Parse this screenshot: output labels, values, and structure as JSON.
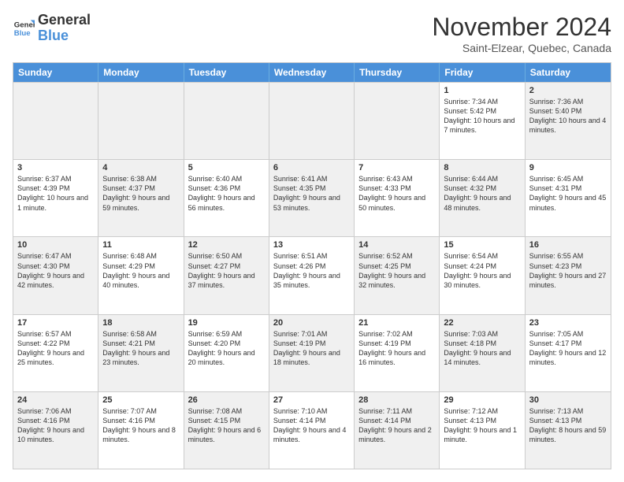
{
  "logo": {
    "line1": "General",
    "line2": "Blue"
  },
  "title": "November 2024",
  "subtitle": "Saint-Elzear, Quebec, Canada",
  "header_days": [
    "Sunday",
    "Monday",
    "Tuesday",
    "Wednesday",
    "Thursday",
    "Friday",
    "Saturday"
  ],
  "rows": [
    [
      {
        "day": "",
        "info": "",
        "shaded": true
      },
      {
        "day": "",
        "info": "",
        "shaded": true
      },
      {
        "day": "",
        "info": "",
        "shaded": true
      },
      {
        "day": "",
        "info": "",
        "shaded": true
      },
      {
        "day": "",
        "info": "",
        "shaded": true
      },
      {
        "day": "1",
        "info": "Sunrise: 7:34 AM\nSunset: 5:42 PM\nDaylight: 10 hours and 7 minutes.",
        "shaded": false
      },
      {
        "day": "2",
        "info": "Sunrise: 7:36 AM\nSunset: 5:40 PM\nDaylight: 10 hours and 4 minutes.",
        "shaded": true
      }
    ],
    [
      {
        "day": "3",
        "info": "Sunrise: 6:37 AM\nSunset: 4:39 PM\nDaylight: 10 hours and 1 minute.",
        "shaded": false
      },
      {
        "day": "4",
        "info": "Sunrise: 6:38 AM\nSunset: 4:37 PM\nDaylight: 9 hours and 59 minutes.",
        "shaded": true
      },
      {
        "day": "5",
        "info": "Sunrise: 6:40 AM\nSunset: 4:36 PM\nDaylight: 9 hours and 56 minutes.",
        "shaded": false
      },
      {
        "day": "6",
        "info": "Sunrise: 6:41 AM\nSunset: 4:35 PM\nDaylight: 9 hours and 53 minutes.",
        "shaded": true
      },
      {
        "day": "7",
        "info": "Sunrise: 6:43 AM\nSunset: 4:33 PM\nDaylight: 9 hours and 50 minutes.",
        "shaded": false
      },
      {
        "day": "8",
        "info": "Sunrise: 6:44 AM\nSunset: 4:32 PM\nDaylight: 9 hours and 48 minutes.",
        "shaded": true
      },
      {
        "day": "9",
        "info": "Sunrise: 6:45 AM\nSunset: 4:31 PM\nDaylight: 9 hours and 45 minutes.",
        "shaded": false
      }
    ],
    [
      {
        "day": "10",
        "info": "Sunrise: 6:47 AM\nSunset: 4:30 PM\nDaylight: 9 hours and 42 minutes.",
        "shaded": true
      },
      {
        "day": "11",
        "info": "Sunrise: 6:48 AM\nSunset: 4:29 PM\nDaylight: 9 hours and 40 minutes.",
        "shaded": false
      },
      {
        "day": "12",
        "info": "Sunrise: 6:50 AM\nSunset: 4:27 PM\nDaylight: 9 hours and 37 minutes.",
        "shaded": true
      },
      {
        "day": "13",
        "info": "Sunrise: 6:51 AM\nSunset: 4:26 PM\nDaylight: 9 hours and 35 minutes.",
        "shaded": false
      },
      {
        "day": "14",
        "info": "Sunrise: 6:52 AM\nSunset: 4:25 PM\nDaylight: 9 hours and 32 minutes.",
        "shaded": true
      },
      {
        "day": "15",
        "info": "Sunrise: 6:54 AM\nSunset: 4:24 PM\nDaylight: 9 hours and 30 minutes.",
        "shaded": false
      },
      {
        "day": "16",
        "info": "Sunrise: 6:55 AM\nSunset: 4:23 PM\nDaylight: 9 hours and 27 minutes.",
        "shaded": true
      }
    ],
    [
      {
        "day": "17",
        "info": "Sunrise: 6:57 AM\nSunset: 4:22 PM\nDaylight: 9 hours and 25 minutes.",
        "shaded": false
      },
      {
        "day": "18",
        "info": "Sunrise: 6:58 AM\nSunset: 4:21 PM\nDaylight: 9 hours and 23 minutes.",
        "shaded": true
      },
      {
        "day": "19",
        "info": "Sunrise: 6:59 AM\nSunset: 4:20 PM\nDaylight: 9 hours and 20 minutes.",
        "shaded": false
      },
      {
        "day": "20",
        "info": "Sunrise: 7:01 AM\nSunset: 4:19 PM\nDaylight: 9 hours and 18 minutes.",
        "shaded": true
      },
      {
        "day": "21",
        "info": "Sunrise: 7:02 AM\nSunset: 4:19 PM\nDaylight: 9 hours and 16 minutes.",
        "shaded": false
      },
      {
        "day": "22",
        "info": "Sunrise: 7:03 AM\nSunset: 4:18 PM\nDaylight: 9 hours and 14 minutes.",
        "shaded": true
      },
      {
        "day": "23",
        "info": "Sunrise: 7:05 AM\nSunset: 4:17 PM\nDaylight: 9 hours and 12 minutes.",
        "shaded": false
      }
    ],
    [
      {
        "day": "24",
        "info": "Sunrise: 7:06 AM\nSunset: 4:16 PM\nDaylight: 9 hours and 10 minutes.",
        "shaded": true
      },
      {
        "day": "25",
        "info": "Sunrise: 7:07 AM\nSunset: 4:16 PM\nDaylight: 9 hours and 8 minutes.",
        "shaded": false
      },
      {
        "day": "26",
        "info": "Sunrise: 7:08 AM\nSunset: 4:15 PM\nDaylight: 9 hours and 6 minutes.",
        "shaded": true
      },
      {
        "day": "27",
        "info": "Sunrise: 7:10 AM\nSunset: 4:14 PM\nDaylight: 9 hours and 4 minutes.",
        "shaded": false
      },
      {
        "day": "28",
        "info": "Sunrise: 7:11 AM\nSunset: 4:14 PM\nDaylight: 9 hours and 2 minutes.",
        "shaded": true
      },
      {
        "day": "29",
        "info": "Sunrise: 7:12 AM\nSunset: 4:13 PM\nDaylight: 9 hours and 1 minute.",
        "shaded": false
      },
      {
        "day": "30",
        "info": "Sunrise: 7:13 AM\nSunset: 4:13 PM\nDaylight: 8 hours and 59 minutes.",
        "shaded": true
      }
    ]
  ]
}
